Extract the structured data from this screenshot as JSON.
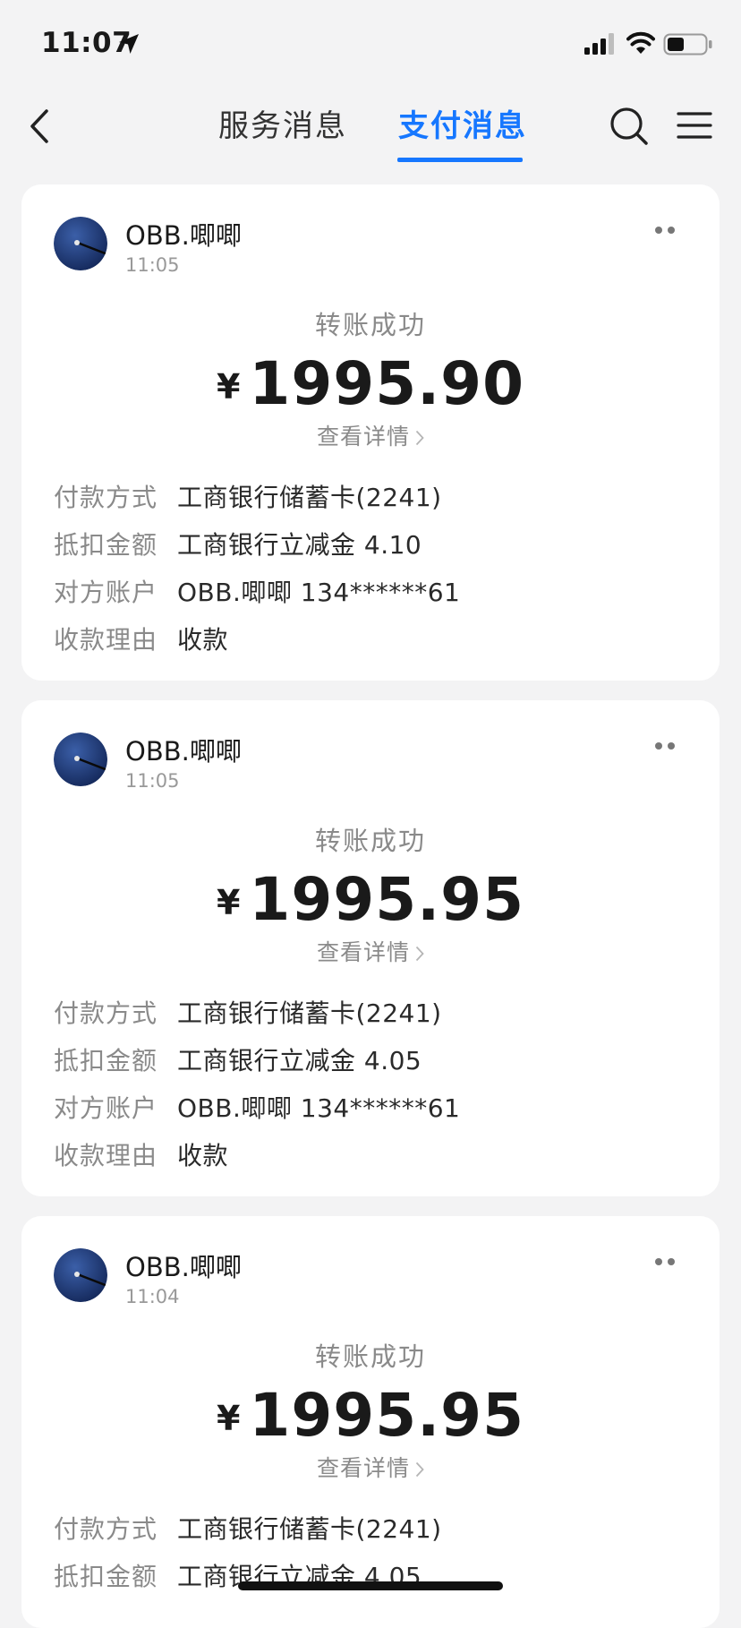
{
  "status_bar": {
    "time": "11:07",
    "icons": [
      "location-arrow-icon",
      "cellular-signal-icon",
      "wifi-icon",
      "battery-icon"
    ]
  },
  "nav": {
    "tabs": [
      {
        "label": "服务消息",
        "active": false
      },
      {
        "label": "支付消息",
        "active": true
      }
    ],
    "icons": [
      "back-chevron-icon",
      "search-icon",
      "menu-icon"
    ],
    "accent_color": "#1677ff"
  },
  "labels": {
    "payment_method": "付款方式",
    "deduction_amount": "抵扣金额",
    "counterparty_account": "对方账户",
    "reason": "收款理由"
  },
  "messages": [
    {
      "sender": "OBB.唧唧",
      "time": "11:05",
      "status": "转账成功",
      "currency": "¥",
      "amount": "1995.90",
      "detail_link": "查看详情",
      "payment_method": "工商银行储蓄卡(2241)",
      "deduction_amount": "工商银行立减金 4.10",
      "counterparty_account": "OBB.唧唧 134******61",
      "reason": "收款"
    },
    {
      "sender": "OBB.唧唧",
      "time": "11:05",
      "status": "转账成功",
      "currency": "¥",
      "amount": "1995.95",
      "detail_link": "查看详情",
      "payment_method": "工商银行储蓄卡(2241)",
      "deduction_amount": "工商银行立减金 4.05",
      "counterparty_account": "OBB.唧唧 134******61",
      "reason": "收款"
    },
    {
      "sender": "OBB.唧唧",
      "time": "11:04",
      "status": "转账成功",
      "currency": "¥",
      "amount": "1995.95",
      "detail_link": "查看详情",
      "payment_method": "工商银行储蓄卡(2241)",
      "deduction_amount": "工商银行立减金 4.05"
    }
  ]
}
